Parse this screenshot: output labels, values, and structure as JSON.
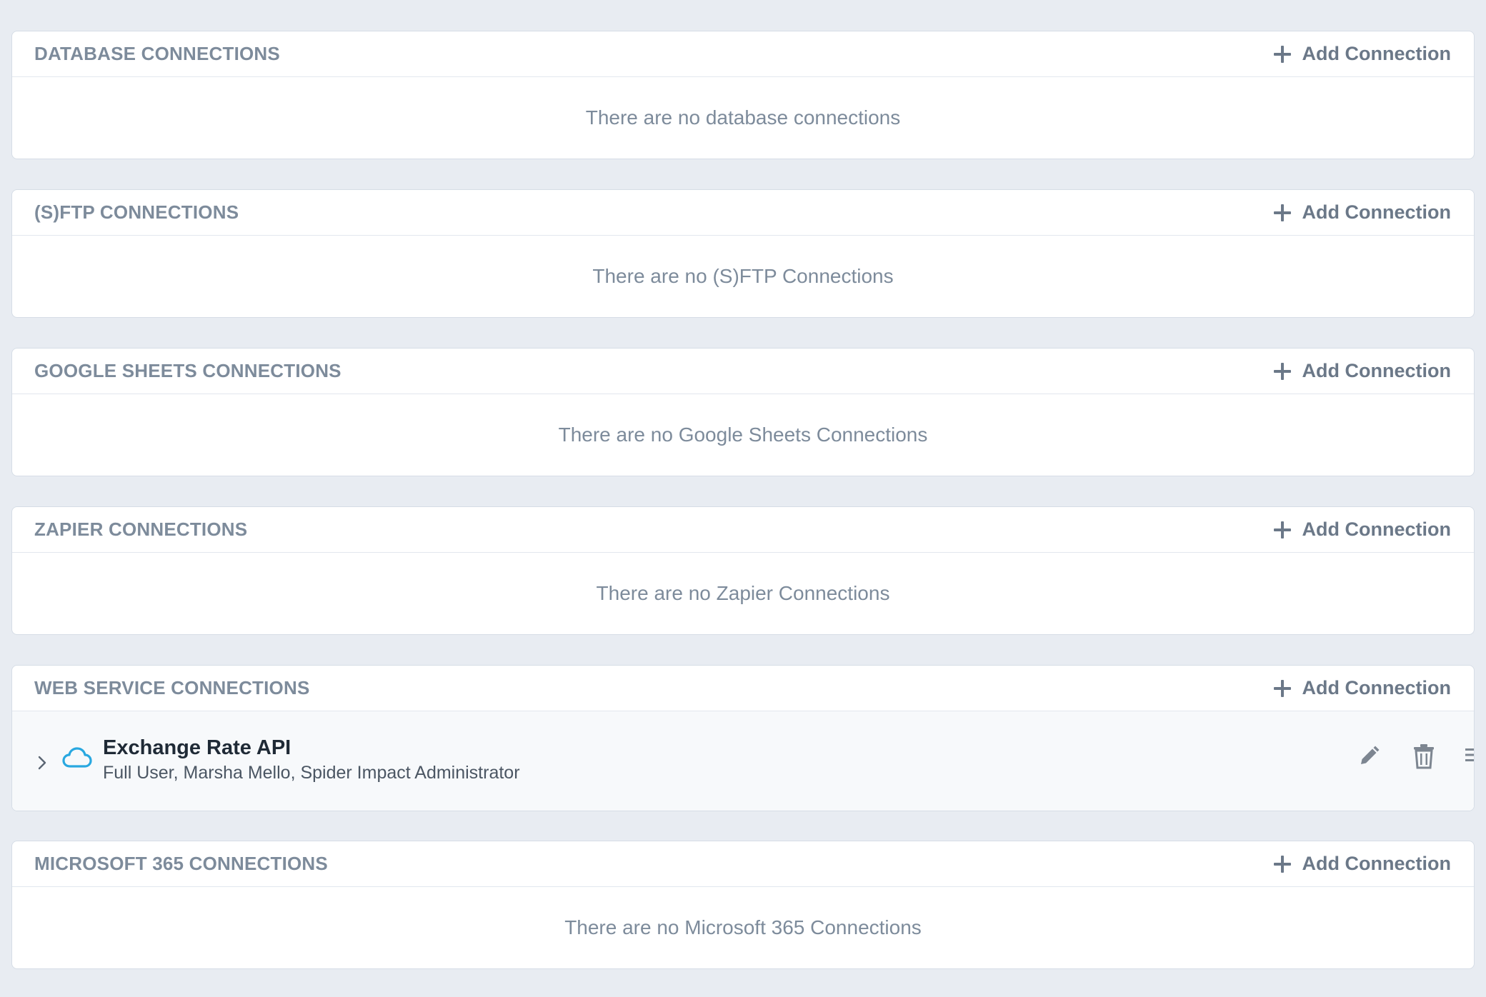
{
  "add_label": "Add Connection",
  "panels": [
    {
      "title": "DATABASE CONNECTIONS",
      "empty": "There are no database connections"
    },
    {
      "title": "(S)FTP CONNECTIONS",
      "empty": "There are no (S)FTP Connections"
    },
    {
      "title": "GOOGLE SHEETS CONNECTIONS",
      "empty": "There are no Google Sheets Connections"
    },
    {
      "title": "ZAPIER CONNECTIONS",
      "empty": "There are no Zapier Connections"
    },
    {
      "title": "WEB SERVICE CONNECTIONS",
      "connection": {
        "name": "Exchange Rate API",
        "detail": "Full User, Marsha Mello, Spider Impact Administrator",
        "icon": "cloud-icon"
      }
    },
    {
      "title": "MICROSOFT 365 CONNECTIONS",
      "empty": "There are no Microsoft 365 Connections"
    }
  ],
  "colors": {
    "background": "#e8ecf2",
    "panel": "#ffffff",
    "header_text": "#7d8b9b",
    "accent_cloud": "#29a8e0",
    "name_text": "#1f2a36"
  }
}
